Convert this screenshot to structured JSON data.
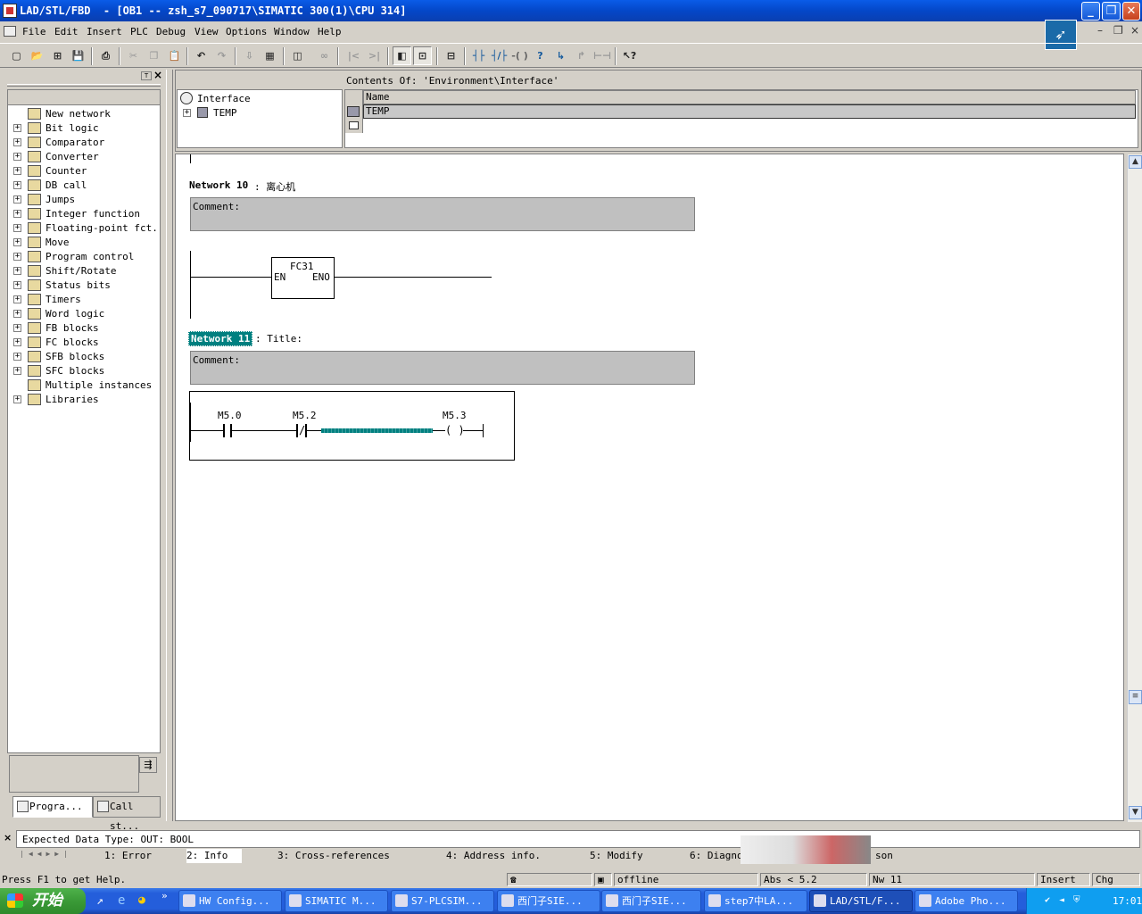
{
  "window": {
    "title": "LAD/STL/FBD  - [OB1 -- zsh_s7_090717\\SIMATIC 300(1)\\CPU 314]"
  },
  "menu": [
    "File",
    "Edit",
    "Insert",
    "PLC",
    "Debug",
    "View",
    "Options",
    "Window",
    "Help"
  ],
  "catalog": {
    "items": [
      {
        "label": "New network",
        "icon": "new-network-icon",
        "expandable": false
      },
      {
        "label": "Bit logic",
        "icon": "bit-logic-icon",
        "expandable": true
      },
      {
        "label": "Comparator",
        "icon": "comparator-icon",
        "expandable": true
      },
      {
        "label": "Converter",
        "icon": "converter-icon",
        "expandable": true
      },
      {
        "label": "Counter",
        "icon": "counter-icon",
        "expandable": true
      },
      {
        "label": "DB call",
        "icon": "db-call-icon",
        "expandable": true
      },
      {
        "label": "Jumps",
        "icon": "jumps-icon",
        "expandable": true
      },
      {
        "label": "Integer function",
        "icon": "integer-function-icon",
        "expandable": true
      },
      {
        "label": "Floating-point fct.",
        "icon": "floating-point-icon",
        "expandable": true
      },
      {
        "label": "Move",
        "icon": "move-icon",
        "expandable": true
      },
      {
        "label": "Program control",
        "icon": "program-control-icon",
        "expandable": true
      },
      {
        "label": "Shift/Rotate",
        "icon": "shift-rotate-icon",
        "expandable": true
      },
      {
        "label": "Status bits",
        "icon": "status-bits-icon",
        "expandable": true
      },
      {
        "label": "Timers",
        "icon": "timers-icon",
        "expandable": true
      },
      {
        "label": "Word logic",
        "icon": "word-logic-icon",
        "expandable": true
      },
      {
        "label": "FB blocks",
        "icon": "fb-blocks-icon",
        "expandable": true
      },
      {
        "label": "FC blocks",
        "icon": "fc-blocks-icon",
        "expandable": true
      },
      {
        "label": "SFB blocks",
        "icon": "sfb-blocks-icon",
        "expandable": true
      },
      {
        "label": "SFC blocks",
        "icon": "sfc-blocks-icon",
        "expandable": true
      },
      {
        "label": "Multiple instances",
        "icon": "multiple-instances-icon",
        "expandable": false
      },
      {
        "label": "Libraries",
        "icon": "libraries-icon",
        "expandable": true
      }
    ],
    "tabs": [
      "Progra...",
      "Call st..."
    ]
  },
  "interface": {
    "root": "Interface",
    "child": "TEMP",
    "contents_header": "Contents Of: 'Environment\\Interface'",
    "column_name": "Name",
    "rows": [
      "TEMP"
    ]
  },
  "networks": [
    {
      "label": "Network 10",
      "title": ": 离心机",
      "comment": "Comment:",
      "block": {
        "name": "FC31",
        "in": "EN",
        "out": "ENO"
      }
    },
    {
      "label": "Network 11",
      "title": ": Title:",
      "comment": "Comment:",
      "contacts": [
        {
          "addr": "M5.0",
          "type": "NO"
        },
        {
          "addr": "M5.2",
          "type": "NC"
        }
      ],
      "coil": {
        "addr": "M5.3",
        "symbol": "( )"
      }
    }
  ],
  "info": {
    "message": "Expected Data Type: OUT: BOOL",
    "tabs": [
      "1: Error",
      "2: Info",
      "3: Cross-references",
      "4: Address info.",
      "5: Modify",
      "6: Diagno",
      "son"
    ]
  },
  "status": {
    "help": "Press F1 to get Help.",
    "mode": "offline",
    "abs": "Abs < 5.2",
    "nw": "Nw 11",
    "insert": "Insert",
    "chg": "Chg"
  },
  "taskbar": {
    "start": "开始",
    "tasks": [
      "HW Config...",
      "SIMATIC M...",
      "S7-PLCSIM...",
      "西门子SIE...",
      "西门子SIE...",
      "step7中LA...",
      "LAD/STL/F...",
      "Adobe Pho..."
    ],
    "clock": "17:01"
  },
  "colors": {
    "accent": "#0a5ce8",
    "highlight": "#008080",
    "taskbar": "#245edb"
  }
}
